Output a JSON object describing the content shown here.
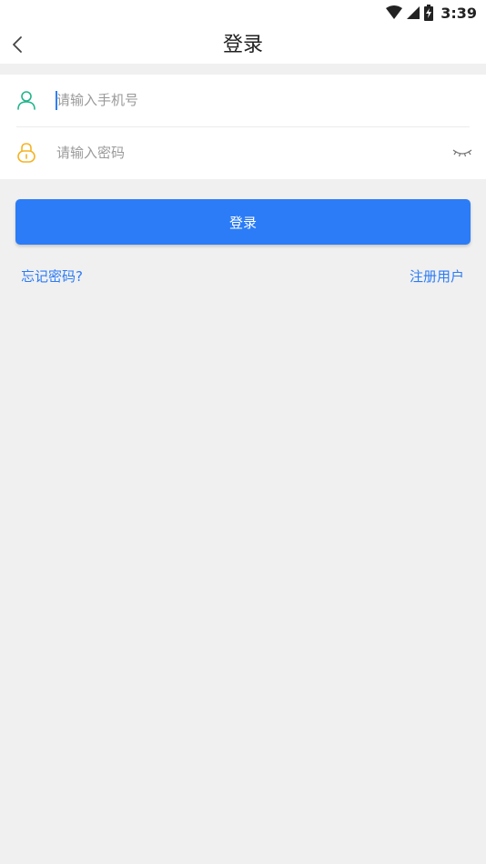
{
  "status_bar": {
    "time": "3:39",
    "icons": [
      "wifi-icon",
      "cellular-signal-icon",
      "battery-charging-icon"
    ]
  },
  "header": {
    "title": "登录",
    "back_icon": "chevron-left-icon"
  },
  "form": {
    "phone": {
      "icon": "user-icon",
      "placeholder": "请输入手机号",
      "value": ""
    },
    "password": {
      "icon": "lock-icon",
      "placeholder": "请输入密码",
      "value": "",
      "toggle_icon": "eye-closed-icon"
    }
  },
  "actions": {
    "login_label": "登录",
    "forgot_password": "忘记密码?",
    "register": "注册用户"
  },
  "colors": {
    "accent": "#2b7cf6",
    "user_icon": "#1fb58a",
    "lock_icon": "#f5b324",
    "background": "#f0f0f0"
  }
}
